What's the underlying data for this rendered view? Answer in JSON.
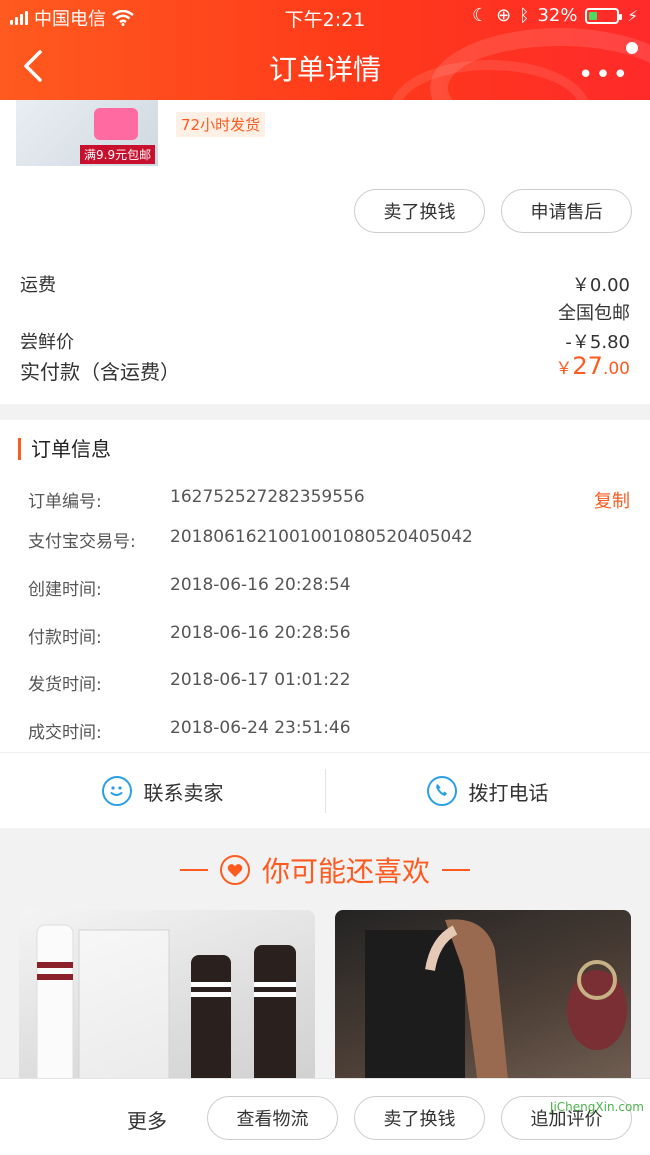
{
  "status_bar": {
    "carrier": "中国电信",
    "time": "下午2:21",
    "battery_percent": "32%",
    "battery_level": 0.32
  },
  "header": {
    "title": "订单详情"
  },
  "product": {
    "thumb_tag": "满9.9元包邮",
    "ship_tag": "72小时发货",
    "sell_button": "卖了换钱",
    "after_sale_button": "申请售后"
  },
  "price": {
    "shipping_label": "运费",
    "shipping_value": "￥0.00",
    "shipping_note": "全国包邮",
    "discount_label": "尝鲜价",
    "discount_value": "-￥5.80",
    "paid_label": "实付款（含运费）",
    "paid_currency": "￥",
    "paid_int": "27",
    "paid_dec": ".00"
  },
  "order_info": {
    "title": "订单信息",
    "copy": "复制",
    "rows": [
      {
        "label": "订单编号:",
        "value": "162752527282359556"
      },
      {
        "label": "支付宝交易号:",
        "value": "2018061621001001080520405042"
      },
      {
        "label": "创建时间:",
        "value": "2018-06-16 20:28:54"
      },
      {
        "label": "付款时间:",
        "value": "2018-06-16 20:28:56"
      },
      {
        "label": "发货时间:",
        "value": "2018-06-17 01:01:22"
      },
      {
        "label": "成交时间:",
        "value": "2018-06-24 23:51:46"
      }
    ]
  },
  "contact": {
    "seller": "联系卖家",
    "call": "拨打电话"
  },
  "recommend": {
    "title": "你可能还喜欢"
  },
  "bottom_bar": {
    "more": "更多",
    "logistics": "查看物流",
    "sell": "卖了换钱",
    "review": "追加评价"
  },
  "watermark": "JiChengXin.com",
  "colors": {
    "accent": "#ff5a1f",
    "link_blue": "#29a0e6"
  }
}
